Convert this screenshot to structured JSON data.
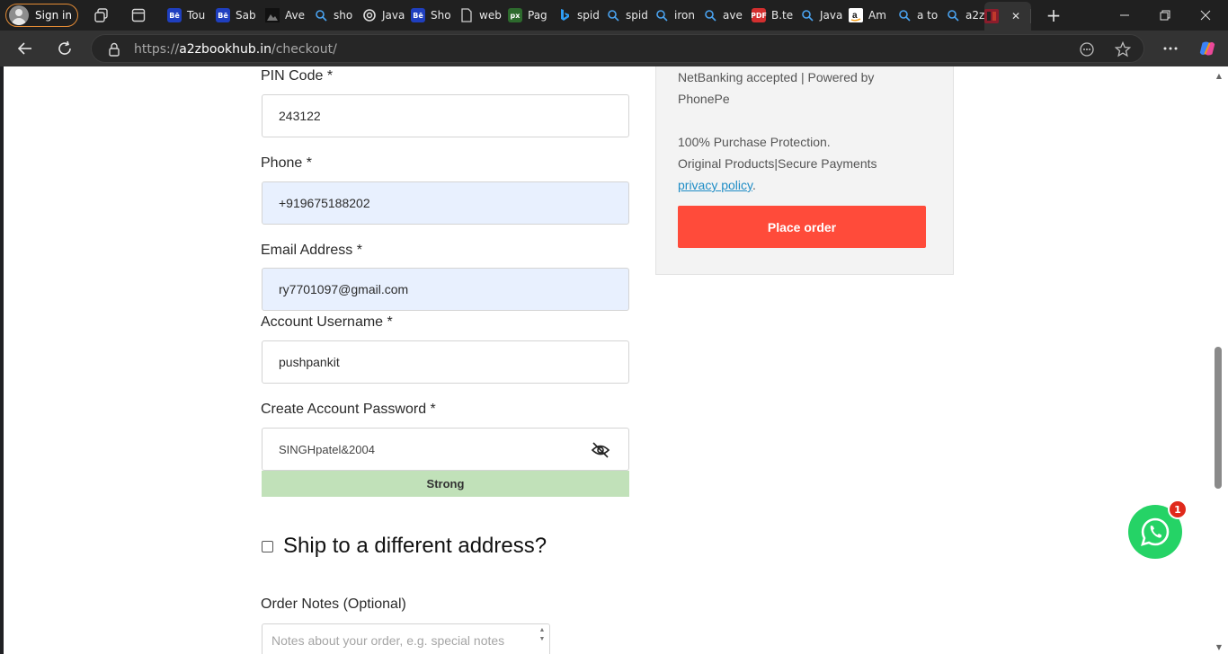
{
  "browser": {
    "signin_label": "Sign in",
    "tabs": [
      {
        "title": "Tou",
        "icon": "behance-icon"
      },
      {
        "title": "Sab",
        "icon": "behance-icon"
      },
      {
        "title": "Ave",
        "icon": "image-icon"
      },
      {
        "title": "sho",
        "icon": "search-icon"
      },
      {
        "title": "Java",
        "icon": "openai-icon"
      },
      {
        "title": "Sho",
        "icon": "behance-icon"
      },
      {
        "title": "web",
        "icon": "page-icon"
      },
      {
        "title": "Pag",
        "icon": "pixel-icon"
      },
      {
        "title": "spid",
        "icon": "bing-icon"
      },
      {
        "title": "spid",
        "icon": "search-icon"
      },
      {
        "title": "iron",
        "icon": "search-icon"
      },
      {
        "title": "ave",
        "icon": "search-icon"
      },
      {
        "title": "B.te",
        "icon": "pdf-icon"
      },
      {
        "title": "Java",
        "icon": "search-icon"
      },
      {
        "title": "Am",
        "icon": "amazon-icon"
      },
      {
        "title": "a to",
        "icon": "search-icon"
      },
      {
        "title": "a2z",
        "icon": "search-icon"
      },
      {
        "title": "",
        "icon": "site-icon",
        "active": true
      }
    ],
    "url_prefix": "https://",
    "url_domain": "a2zbookhub.in",
    "url_path": "/checkout/"
  },
  "form": {
    "pin_label": "PIN Code *",
    "pin_value": "243122",
    "phone_label": "Phone *",
    "phone_value": "+919675188202",
    "email_label": "Email Address *",
    "email_value": "ry7701097@gmail.com",
    "username_label": "Account Username *",
    "username_value": "pushpankit",
    "password_label": "Create Account Password *",
    "password_value": "SINGHpatel&2004",
    "strength_label": "Strong",
    "ship_label": "Ship to a different address?",
    "notes_label": "Order Notes (Optional)",
    "notes_placeholder": "Notes about your order, e.g. special notes"
  },
  "summary": {
    "line1": "NetBanking accepted | Powered by",
    "line2": "PhonePe",
    "line3": "100% Purchase Protection.",
    "line4": "Original Products|Secure Payments",
    "privacy_link": "privacy policy",
    "privacy_suffix": ".",
    "place_order_label": "Place order"
  },
  "whatsapp": {
    "badge_count": "1"
  },
  "colors": {
    "accent": "#ff4b3a",
    "strength": "#c1e1b9",
    "whatsapp": "#25d366",
    "link": "#1f8dc6"
  }
}
